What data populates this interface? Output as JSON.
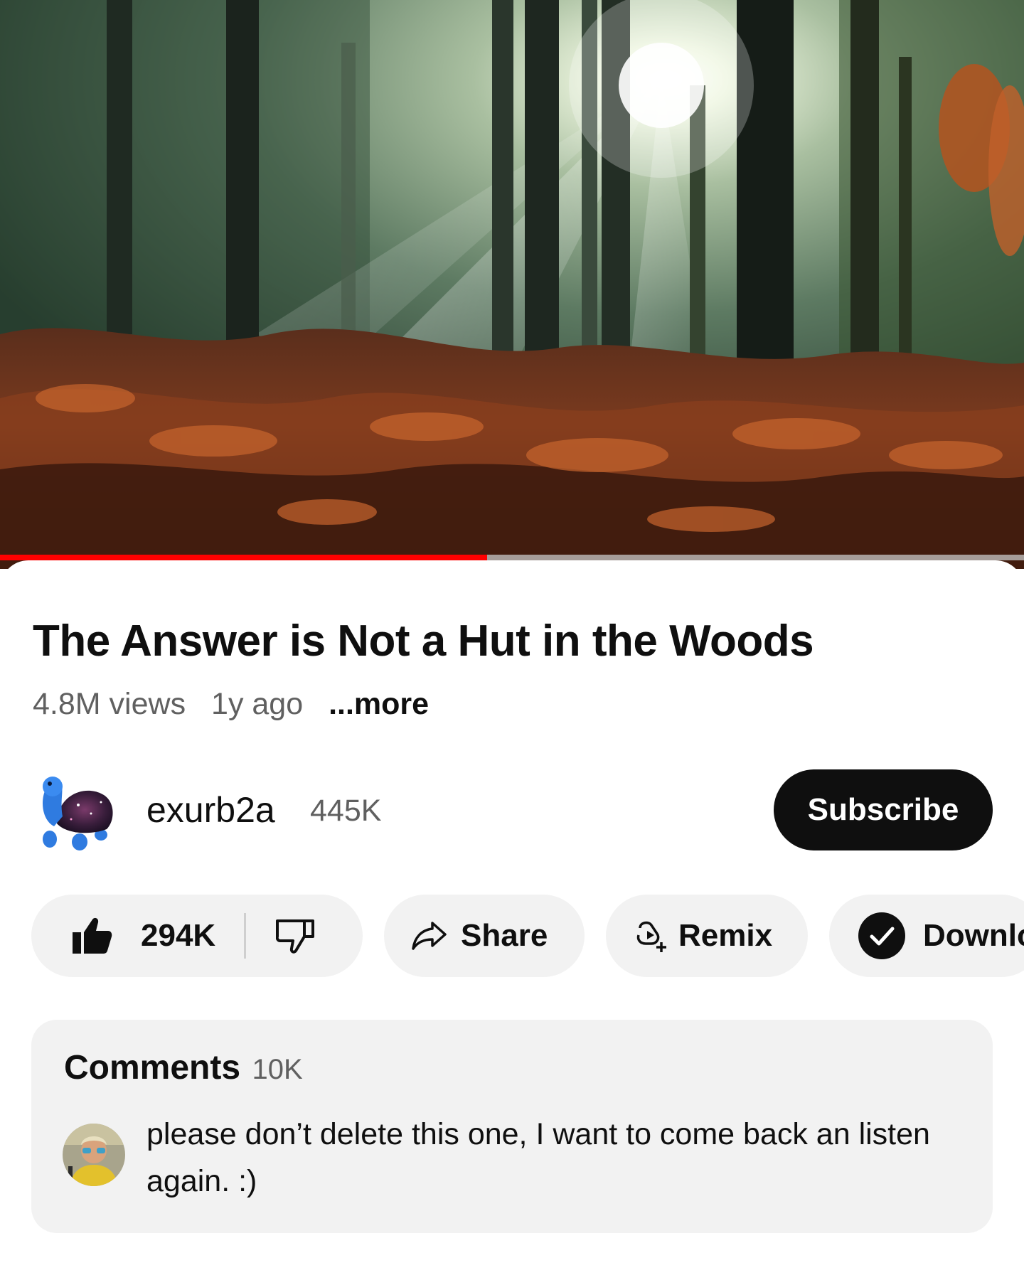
{
  "video": {
    "thumbnail": "misty-forest-sunbeams-autumn-ferns",
    "progress_fraction": 0.476
  },
  "info": {
    "title": "The Answer is Not a Hut in the Woods",
    "views": "4.8M views",
    "age": "1y ago",
    "more_label": "...more"
  },
  "channel": {
    "avatar": "blue-turtle-galaxy-shell-avatar",
    "name": "exurb2a",
    "subscribers": "445K",
    "subscribe_label": "Subscribe"
  },
  "actions": {
    "likes": "294K",
    "like_icon": "thumbs-up-filled-icon",
    "dislike_icon": "thumbs-down-outline-icon",
    "share_label": "Share",
    "share_icon": "share-arrow-icon",
    "remix_label": "Remix",
    "remix_icon": "remix-icon",
    "download_label": "Downlo",
    "download_icon": "check-circle-icon"
  },
  "comments": {
    "title": "Comments",
    "count": "10K",
    "top_comment": {
      "avatar": "user-avatar",
      "text": "please don’t delete this one, I want to come back an listen again. :)"
    }
  },
  "colors": {
    "progress": "#ff0000",
    "pill_bg": "#f2f2f2",
    "subscribe_bg": "#0f0f0f",
    "secondary_text": "#606060"
  }
}
